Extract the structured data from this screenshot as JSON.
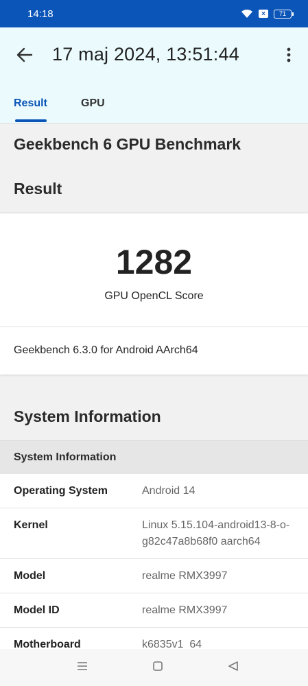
{
  "status_bar": {
    "time": "14:18",
    "battery": "71"
  },
  "app_bar": {
    "title": "17 maj 2024, 13:51:44",
    "tabs": [
      {
        "label": "Result",
        "active": true
      },
      {
        "label": "GPU",
        "active": false
      }
    ]
  },
  "benchmark": {
    "title": "Geekbench 6 GPU Benchmark",
    "result_heading": "Result",
    "score": "1282",
    "score_label": "GPU OpenCL Score",
    "version": "Geekbench 6.3.0 for Android AArch64"
  },
  "system_information": {
    "heading": "System Information",
    "table_header": "System Information",
    "rows": [
      {
        "key": "Operating System",
        "value": "Android 14"
      },
      {
        "key": "Kernel",
        "value": "Linux 5.15.104-android13-8-o-g82c47a8b68f0 aarch64"
      },
      {
        "key": "Model",
        "value": "realme RMX3997"
      },
      {
        "key": "Model ID",
        "value": "realme RMX3997"
      },
      {
        "key": "Motherboard",
        "value": "k6835v1_64"
      }
    ]
  },
  "icons": {
    "back": "arrow-left",
    "more": "more-vert",
    "wifi": "wifi",
    "nav_menu": "menu",
    "nav_home": "square",
    "nav_back": "triangle-left"
  },
  "colors": {
    "accent": "#0b55b8",
    "appbar_bg": "#ebfbfd",
    "page_bg": "#f1f1f1"
  }
}
